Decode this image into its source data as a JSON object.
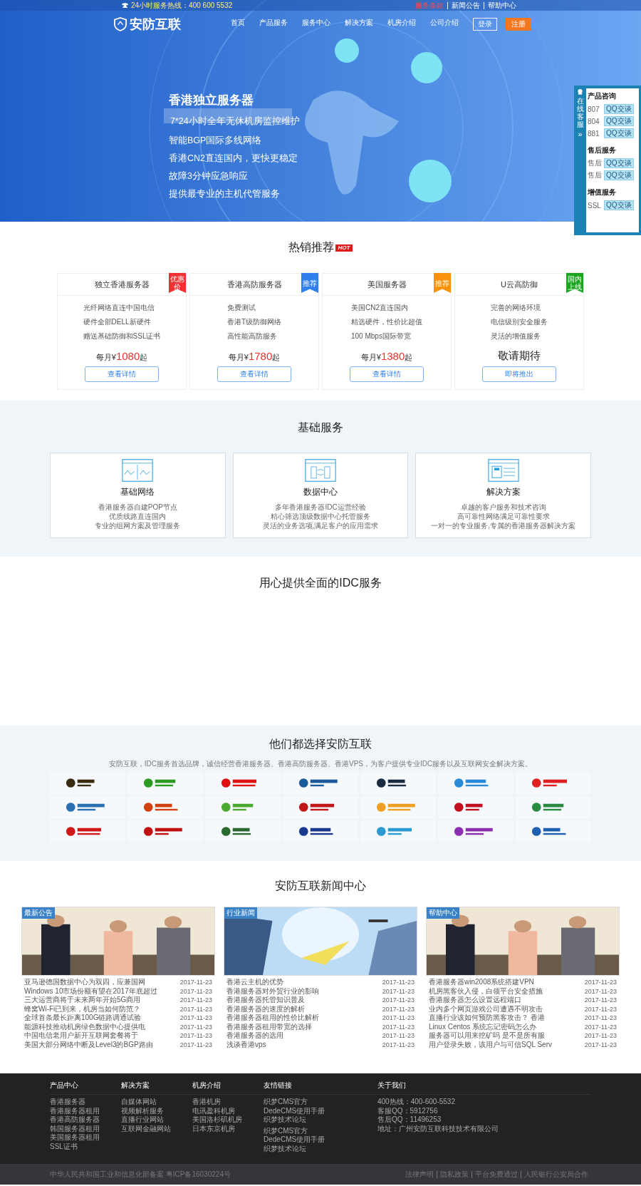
{
  "top_bar": {
    "hotline": "24小时服务热线：400 600 5532",
    "links": [
      "服务条款",
      "新闻公告",
      "帮助中心"
    ]
  },
  "header": {
    "logo": "安防互联",
    "nav": [
      {
        "label": "首页",
        "selected": false
      },
      {
        "label": "产品服务",
        "selected": false
      },
      {
        "label": "服务中心",
        "selected": false
      },
      {
        "label": "解决方案",
        "selected": false
      },
      {
        "label": "机房介绍",
        "selected": false
      },
      {
        "label": "公司介绍",
        "selected": false
      }
    ],
    "login": "登录",
    "register": "注册"
  },
  "hero": {
    "title": "香港独立服务器",
    "subtitle": "7*24小时全年无休机房监控维护",
    "points": [
      "智能BGP国际多线网络",
      "香港CN2直连国内，更快更稳定",
      "故障3分钟应急响应",
      "提供最专业的主机代管服务"
    ]
  },
  "online_service": {
    "title": "在线客服",
    "arrow": "»",
    "groups": [
      {
        "title": "产品咨询",
        "rows": [
          {
            "label": "807",
            "button": "QQ交谈"
          },
          {
            "label": "804",
            "button": "QQ交谈"
          },
          {
            "label": "881",
            "button": "QQ交谈"
          }
        ]
      },
      {
        "title": "售后服务",
        "rows": [
          {
            "label": "售后",
            "button": "QQ交谈"
          },
          {
            "label": "售后",
            "button": "QQ交谈"
          }
        ]
      },
      {
        "title": "增值服务",
        "rows": [
          {
            "label": "SSL",
            "button": "QQ交谈"
          }
        ]
      }
    ]
  },
  "hot": {
    "title": "热销推荐",
    "badge": "HOT",
    "cards": [
      {
        "title": "独立香港服务器",
        "ribbon": "优惠价",
        "color": "#f03030",
        "features": [
          "光纤网络直连中国电信",
          "硬件全部DELL新硬件",
          "赠送基础防御和SSL证书"
        ],
        "kind": "price",
        "price_prefix": "每月¥",
        "price": "1080",
        "price_suffix": "起",
        "button": "查看详情"
      },
      {
        "title": "香港高防服务器",
        "ribbon": "推荐",
        "color": "#2f80ed",
        "features": [
          "免费测试",
          "香港T级防御网络",
          "高性能高防服务"
        ],
        "kind": "price",
        "price_prefix": "每月¥",
        "price": "1780",
        "price_suffix": "起",
        "button": "查看详情"
      },
      {
        "title": "美国服务器",
        "ribbon": "推荐",
        "color": "#f7920a",
        "features": [
          "美国CN2直连国内",
          "精选硬件，性价比超值",
          "100 Mbps国际带宽"
        ],
        "kind": "price",
        "price_prefix": "每月¥",
        "price": "1380",
        "price_suffix": "起",
        "button": "查看详情"
      },
      {
        "title": "U云高防御",
        "ribbon": "国内上线",
        "color": "#18a81e",
        "features": [
          "完善的网络环境",
          "电信级别安全服务",
          "灵活的增值服务"
        ],
        "kind": "coming",
        "text": "敬请期待",
        "button": "即将推出"
      }
    ]
  },
  "basic": {
    "title": "基础服务",
    "cards": [
      {
        "kind": "network",
        "title": "基础网络",
        "lines": [
          "香港服务器自建POP节点",
          "优质线路直连国内",
          "专业的组网方案及管理服务"
        ]
      },
      {
        "kind": "datacenter",
        "title": "数据中心",
        "lines": [
          "多年香港服务器IDC运营经验",
          "精心筛选顶级数据中心托管服务",
          "灵活的业务选项,满足客户的应用需求"
        ]
      },
      {
        "kind": "solution",
        "title": "解决方案",
        "lines": [
          "卓越的客户服务和技术咨询",
          "高可靠性网络满足可靠性要求",
          "一对一的专业服务,专属的香港服务器解决方案"
        ]
      }
    ]
  },
  "idc": {
    "title": "用心提供全面的IDC服务"
  },
  "clients": {
    "title": "他们都选择安防互联",
    "description": "安防互联，IDC服务首选品牌，诚信经营香港服务器、香港高防服务器、香港VPS，为客户提供专业IDC服务以及互联网安全解决方案。"
  },
  "news": {
    "title": "安防互联新闻中心",
    "columns": [
      {
        "tag": "最新公告",
        "items": [
          {
            "title": "亚马逊德国数据中心为双四，应兼国网",
            "date": "2017-11-23"
          },
          {
            "title": "Windows 10市场份额有望在2017年底超过",
            "date": "2017-11-23"
          },
          {
            "title": "三大运营商将于未来两年开始5G商用",
            "date": "2017-11-23"
          },
          {
            "title": "蜂窝Wi-Fi已到来，机房当如何防范？",
            "date": "2017-11-23"
          },
          {
            "title": "全球首条最长距离100G链路调通试验",
            "date": "2017-11-23"
          },
          {
            "title": "能源科技推动机房绿色数据中心提供电",
            "date": "2017-11-23"
          },
          {
            "title": "中国电信老用户新开互联网套餐将于",
            "date": "2017-11-23"
          },
          {
            "title": "美国大部分网络中断及Level3的BGP路由",
            "date": "2017-11-23"
          }
        ]
      },
      {
        "tag": "行业新闻",
        "items": [
          {
            "title": "香港云主机的优势",
            "date": "2017-11-23"
          },
          {
            "title": "香港服务器对外贸行业的影响",
            "date": "2017-11-23"
          },
          {
            "title": "香港服务器托管知识普及",
            "date": "2017-11-23"
          },
          {
            "title": "香港服务器的速度的解析",
            "date": "2017-11-23"
          },
          {
            "title": "香港服务器租用的性价比解析",
            "date": "2017-11-23"
          },
          {
            "title": "香港服务器租用带宽的选择",
            "date": "2017-11-23"
          },
          {
            "title": "香港服务器的选用",
            "date": "2017-11-23"
          },
          {
            "title": "浅谈香港vps",
            "date": "2017-11-23"
          }
        ]
      },
      {
        "tag": "帮助中心",
        "items": [
          {
            "title": "香港服务器win2008系统搭建VPN",
            "date": "2017-11-23"
          },
          {
            "title": "机房黑客伙入侵，白领平台安全措施",
            "date": "2017-11-23"
          },
          {
            "title": "香港服务器怎么设置远程端口",
            "date": "2017-11-23"
          },
          {
            "title": "业内多个网页游戏公司遭遇不明攻击",
            "date": "2017-11-23"
          },
          {
            "title": "直播行业该如何预防黑客攻击？ 香港",
            "date": "2017-11-23"
          },
          {
            "title": "Linux Centos 系统忘记密码怎么办",
            "date": "2017-11-23"
          },
          {
            "title": "服务器可以用来挖矿吗 是不是所有服",
            "date": "2017-11-23"
          },
          {
            "title": "用户登录失败，该用户与可信SQL Serv",
            "date": "2017-11-23"
          }
        ]
      }
    ]
  },
  "footer": {
    "columns": [
      {
        "title": "产品中心",
        "links": [
          "香港服务器",
          "香港服务器租用",
          "香港高防服务器",
          "韩国服务器租用",
          "美国服务器租用",
          "SSL证书"
        ]
      },
      {
        "title": "解决方案",
        "links": [
          "自媒体网站",
          "视频解析服务",
          "直播行业网站",
          "互联网金融网站"
        ]
      },
      {
        "title": "机房介绍",
        "links": [
          "香港机房",
          "电讯盈科机房",
          "美国洛杉矶机房",
          "日本东京机房"
        ]
      },
      {
        "title": "友情链接",
        "links": [
          "织梦CMS官方",
          "DedeCMS使用手册",
          "织梦技术论坛",
          "织梦CMS官方",
          "DedeCMS使用手册",
          "织梦技术论坛"
        ]
      },
      {
        "title": "关于我们",
        "links": [
          "400热线：400-600-5532",
          "客服QQ：5912756",
          "售后QQ：11496253",
          "地址：广州安防互联科技技术有限公司"
        ]
      }
    ],
    "copyright": "中华人民共和国工业和信息化部备案 粤ICP备16030224号",
    "bottom_links": [
      "法律声明",
      "隐私政策",
      "平台免费通过",
      "人民银行公安局合作"
    ]
  }
}
